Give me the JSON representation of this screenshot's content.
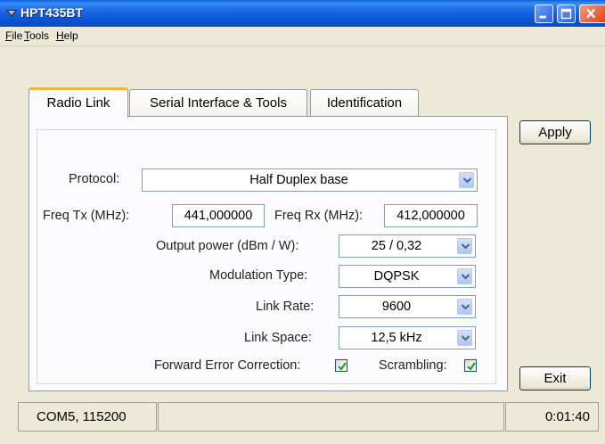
{
  "window": {
    "title": "HPT435BT",
    "icon": "app-icon",
    "controls": [
      "minimize-icon",
      "maximize-icon",
      "close-icon"
    ]
  },
  "menu": {
    "file": {
      "u": "F",
      "rest": "ile"
    },
    "tools": {
      "u": "T",
      "rest": "ools"
    },
    "help": {
      "u": "H",
      "rest": "elp"
    }
  },
  "tabs": {
    "radio_link": "Radio Link",
    "serial": "Serial Interface & Tools",
    "identification": "Identification"
  },
  "form": {
    "protocol_label": "Protocol:",
    "protocol_value": "Half Duplex base",
    "freq_tx_label": "Freq Tx (MHz):",
    "freq_tx_value": "441,000000",
    "freq_rx_label": "Freq Rx (MHz):",
    "freq_rx_value": "412,000000",
    "output_power_label": "Output power (dBm / W):",
    "output_power_value": "25 / 0,32",
    "modulation_label": "Modulation Type:",
    "modulation_value": "DQPSK",
    "link_rate_label": "Link Rate:",
    "link_rate_value": "9600",
    "link_space_label": "Link Space:",
    "link_space_value": "12,5 kHz",
    "fec_label": "Forward Error Correction:",
    "fec_checked": true,
    "scrambling_label": "Scrambling:",
    "scrambling_checked": true
  },
  "buttons": {
    "apply": "Apply",
    "exit": "Exit"
  },
  "status": {
    "port": "COM5, 115200",
    "middle": "",
    "time": "0:01:40"
  },
  "colors": {
    "titlebar": "#0a55d4",
    "active_tab_accent": "#f5b53c",
    "checkmark": "#21a121"
  }
}
